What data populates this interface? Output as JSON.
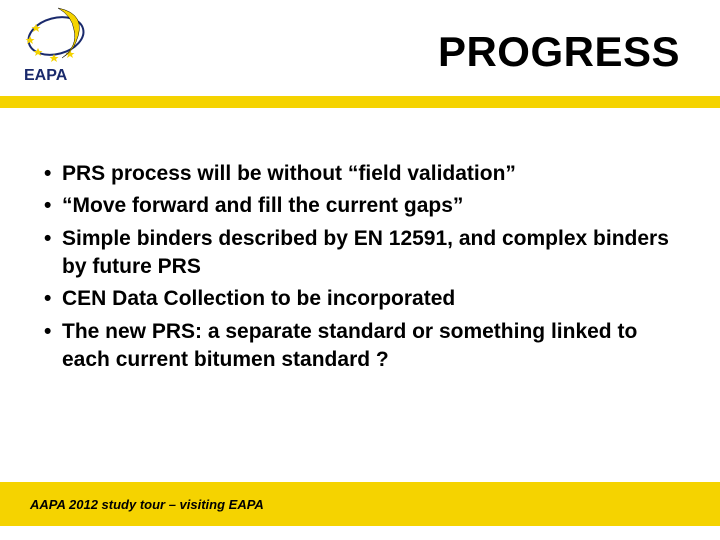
{
  "header": {
    "title": "PROGRESS",
    "logo_text": "EAPA"
  },
  "bullets": [
    "PRS process will be without   “field validation”",
    "“Move forward and fill the current gaps”",
    "Simple binders  described by EN 12591, and complex binders by future PRS",
    "CEN Data Collection to be incorporated",
    "The new PRS: a separate standard or something linked to each current bitumen standard ?"
  ],
  "footer": {
    "text": "AAPA 2012 study tour – visiting EAPA"
  }
}
